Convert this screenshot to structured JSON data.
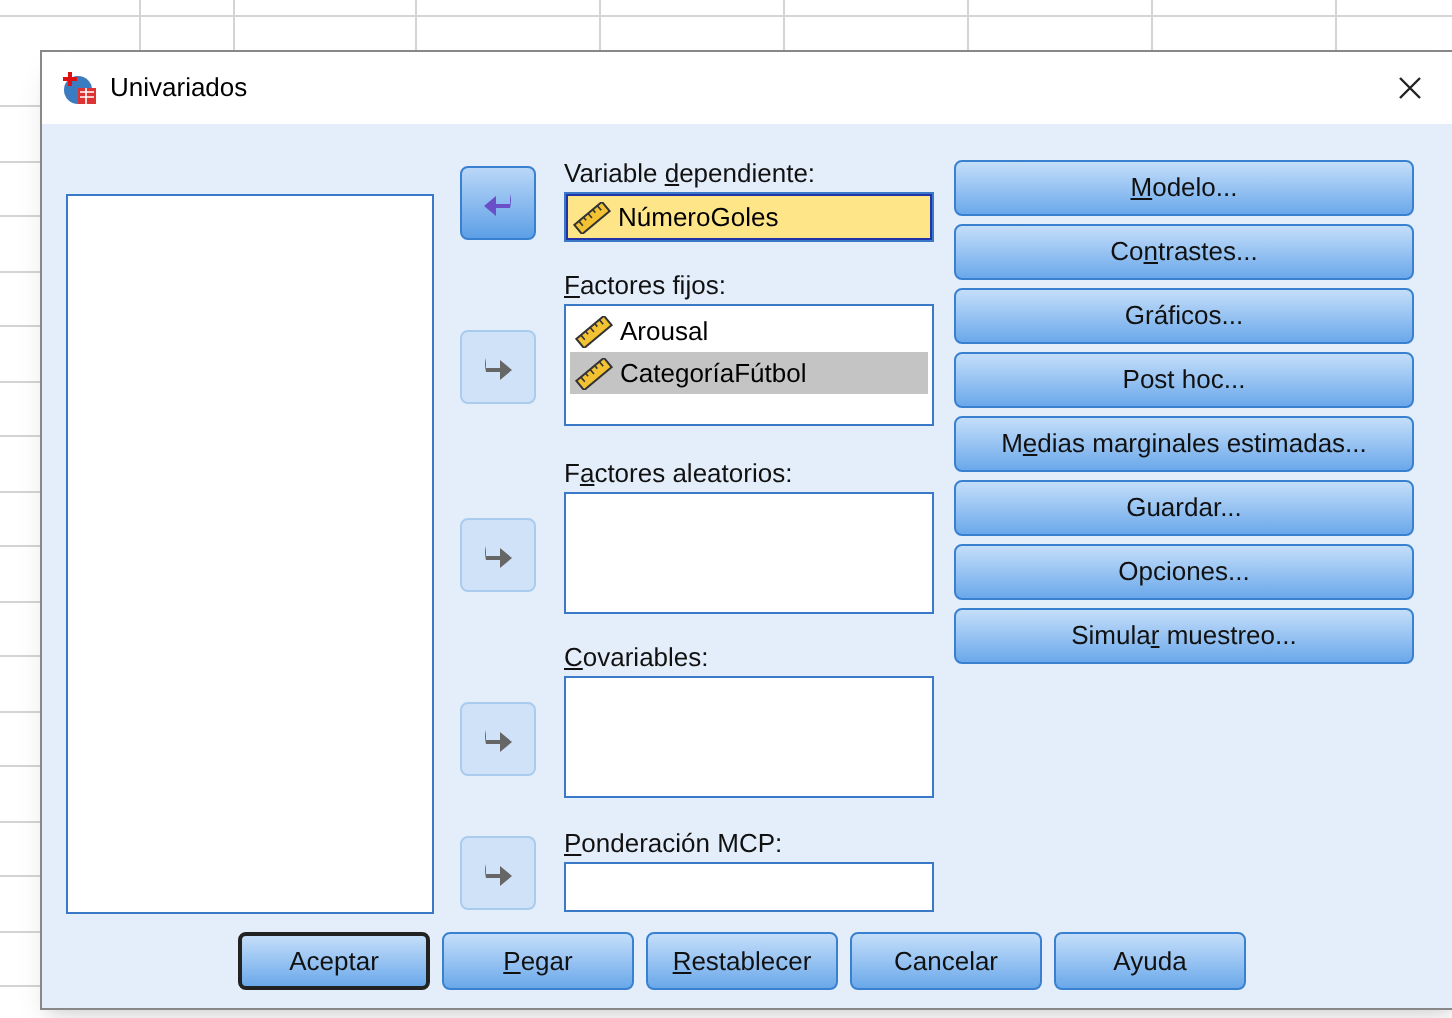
{
  "window": {
    "title": "Univariados"
  },
  "targets": [
    {
      "kind": "field",
      "label": [
        {
          "text": "Variable "
        },
        {
          "text": "d",
          "mnemonic": true
        },
        {
          "text": "ependiente:"
        }
      ],
      "arrow": {
        "enabled": true,
        "points_left": true
      },
      "items": [
        {
          "name": "NúmeroGoles",
          "selected": true
        }
      ]
    },
    {
      "kind": "list",
      "label": [
        {
          "text": "F",
          "mnemonic": true
        },
        {
          "text": "actores fijos:"
        }
      ],
      "arrow": {
        "enabled": false,
        "points_left": false
      },
      "items": [
        {
          "name": "Arousal",
          "selected": false
        },
        {
          "name": "CategoríaFútbol",
          "selected": true
        }
      ]
    },
    {
      "kind": "list",
      "label": [
        {
          "text": "F"
        },
        {
          "text": "a",
          "mnemonic": true
        },
        {
          "text": "ctores aleatorios:"
        }
      ],
      "arrow": {
        "enabled": false,
        "points_left": false
      }
    },
    {
      "kind": "list",
      "label": [
        {
          "text": "C",
          "mnemonic": true
        },
        {
          "text": "ovariables:"
        }
      ],
      "arrow": {
        "enabled": false,
        "points_left": false
      }
    },
    {
      "kind": "field",
      "label": [
        {
          "text": "P",
          "mnemonic": true
        },
        {
          "text": "onderación MCP:"
        }
      ],
      "arrow": {
        "enabled": false,
        "points_left": false
      }
    }
  ],
  "side_buttons": [
    {
      "label": [
        {
          "text": "M",
          "mnemonic": true
        },
        {
          "text": "odelo..."
        }
      ]
    },
    {
      "label": [
        {
          "text": "Co"
        },
        {
          "text": "n",
          "mnemonic": true
        },
        {
          "text": "trastes..."
        }
      ]
    },
    {
      "label": [
        {
          "text": "Gráficos..."
        }
      ]
    },
    {
      "label": [
        {
          "text": "Post hoc..."
        }
      ]
    },
    {
      "label": [
        {
          "text": "M"
        },
        {
          "text": "e",
          "mnemonic": true
        },
        {
          "text": "dias marginales estimadas..."
        }
      ]
    },
    {
      "label": [
        {
          "text": "Guardar..."
        }
      ]
    },
    {
      "label": [
        {
          "text": "Opciones..."
        }
      ]
    },
    {
      "label": [
        {
          "text": "Simula"
        },
        {
          "text": "r",
          "mnemonic": true
        },
        {
          "text": " muestreo..."
        }
      ]
    }
  ],
  "bottom_buttons": [
    {
      "label": [
        {
          "text": "Aceptar"
        }
      ],
      "default": true
    },
    {
      "label": [
        {
          "text": "P",
          "mnemonic": true
        },
        {
          "text": "egar"
        }
      ],
      "default": false
    },
    {
      "label": [
        {
          "text": "R",
          "mnemonic": true
        },
        {
          "text": "establecer"
        }
      ],
      "default": false
    },
    {
      "label": [
        {
          "text": "Cancelar"
        }
      ],
      "default": false
    },
    {
      "label": [
        {
          "text": "Ayuda"
        }
      ],
      "default": false
    }
  ]
}
